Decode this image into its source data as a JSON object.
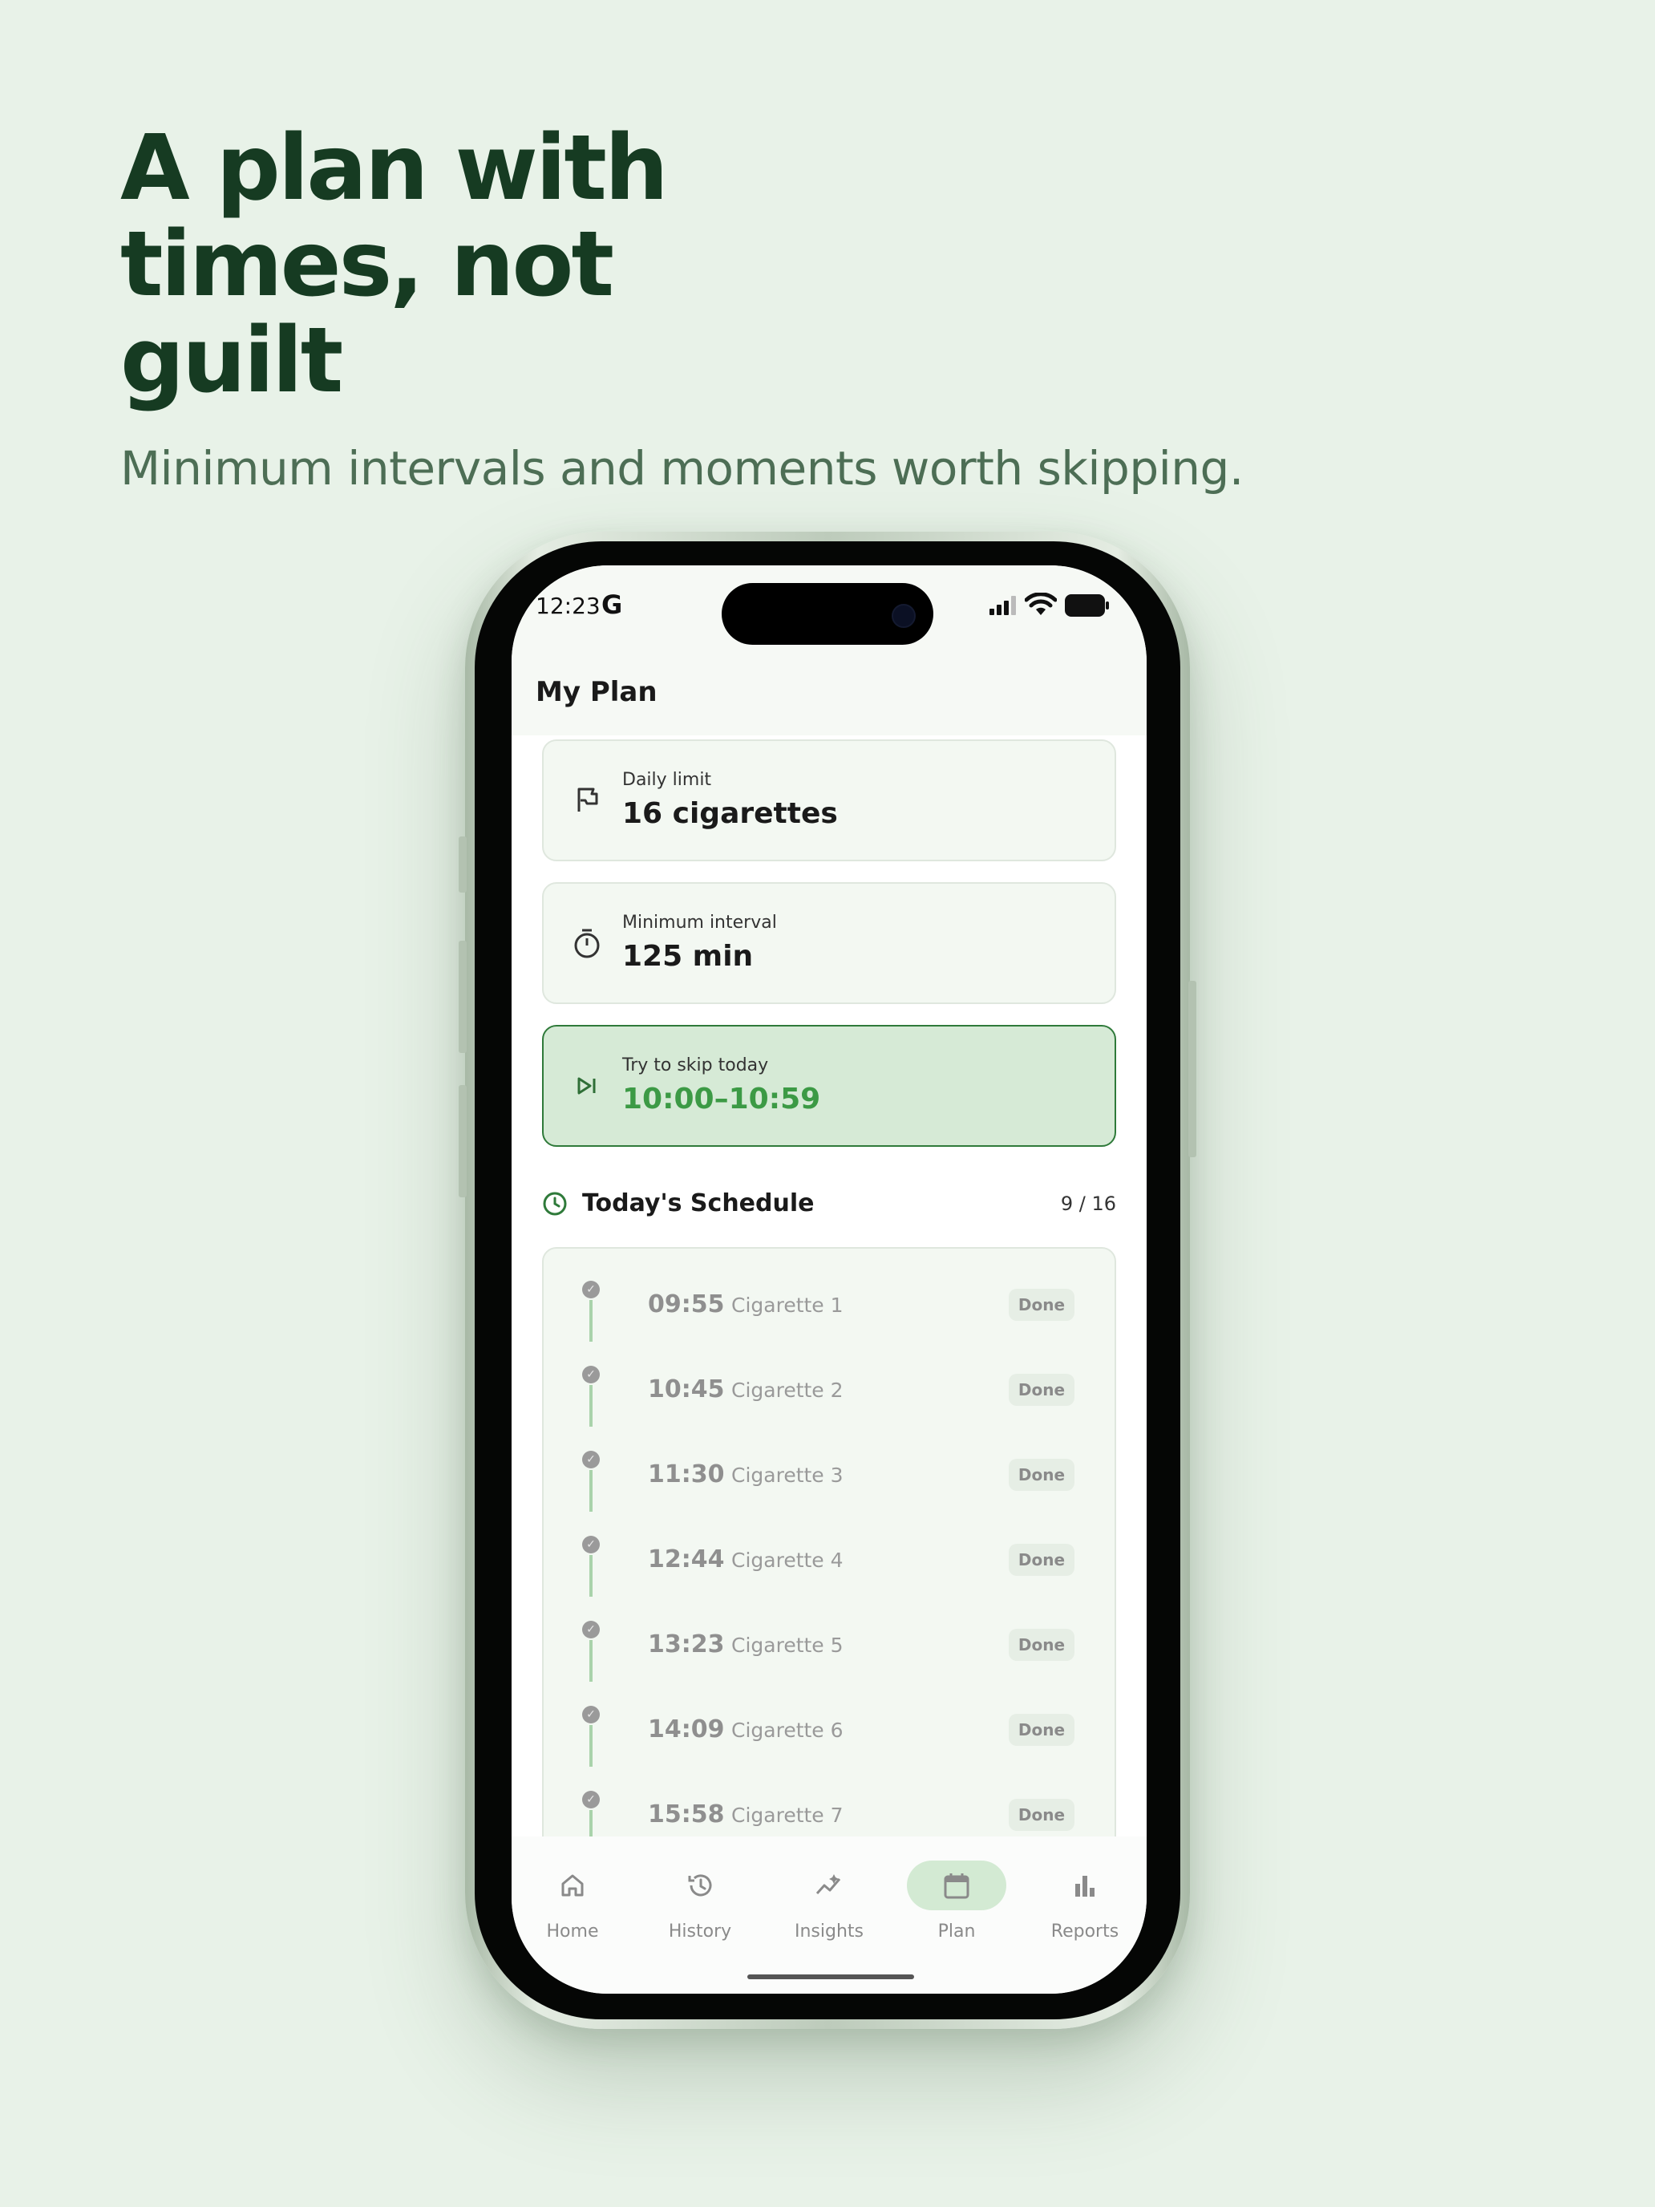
{
  "hero": {
    "headline": "A plan with times, not guilt",
    "subhead": "Minimum intervals and moments worth skipping."
  },
  "status_bar": {
    "time": "12:23",
    "carrier_glyph": "G"
  },
  "screen": {
    "title": "My Plan"
  },
  "cards": [
    {
      "label": "Daily limit",
      "value": "16 cigarettes",
      "icon": "flag-icon"
    },
    {
      "label": "Minimum interval",
      "value": "125 min",
      "icon": "timer-icon"
    },
    {
      "label": "Try to skip today",
      "value": "10:00–10:59",
      "icon": "skip-next-icon"
    }
  ],
  "schedule": {
    "title": "Today's Schedule",
    "count": "9 / 16",
    "items": [
      {
        "time": "09:55",
        "label": "Cigarette 1",
        "status": "Done"
      },
      {
        "time": "10:45",
        "label": "Cigarette 2",
        "status": "Done"
      },
      {
        "time": "11:30",
        "label": "Cigarette 3",
        "status": "Done"
      },
      {
        "time": "12:44",
        "label": "Cigarette 4",
        "status": "Done"
      },
      {
        "time": "13:23",
        "label": "Cigarette 5",
        "status": "Done"
      },
      {
        "time": "14:09",
        "label": "Cigarette 6",
        "status": "Done"
      },
      {
        "time": "15:58",
        "label": "Cigarette 7",
        "status": "Done"
      }
    ]
  },
  "nav": {
    "active": "Plan",
    "items": [
      {
        "label": "Home",
        "icon": "home-icon"
      },
      {
        "label": "History",
        "icon": "history-icon"
      },
      {
        "label": "Insights",
        "icon": "insights-icon"
      },
      {
        "label": "Plan",
        "icon": "calendar-icon"
      },
      {
        "label": "Reports",
        "icon": "bar-chart-icon"
      }
    ]
  },
  "colors": {
    "background": "#e8f2e8",
    "headline": "#163b22",
    "accent": "#3c9a45",
    "skip_card_bg": "#d6ead6"
  }
}
